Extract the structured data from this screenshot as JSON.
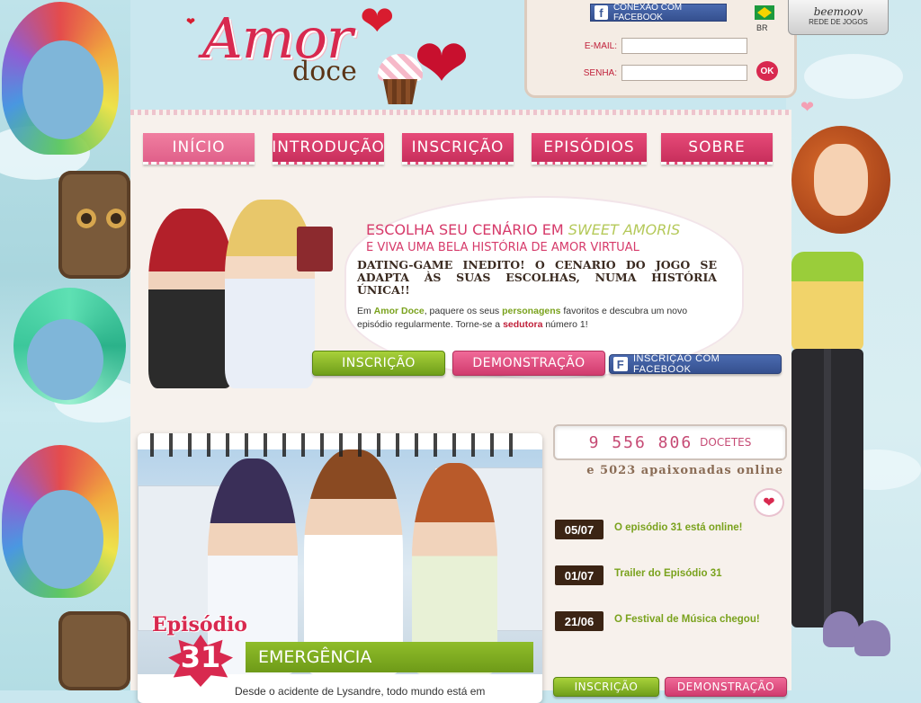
{
  "header": {
    "logo_main": "Amor",
    "logo_sub": "doce",
    "facebook_connect": "CONEXÃO COM FACEBOOK",
    "language": "BR",
    "email_label": "E-MAIL:",
    "password_label": "SENHA:",
    "email_value": "",
    "password_value": "",
    "ok_label": "OK",
    "network_brand": "beemoov",
    "network_sub": "REDE DE JOGOS"
  },
  "nav": {
    "items": [
      {
        "label": "Início"
      },
      {
        "label": "Introdução"
      },
      {
        "label": "Inscrição"
      },
      {
        "label": "Episódios"
      },
      {
        "label": "Sobre"
      }
    ]
  },
  "hero": {
    "title_pre": "ESCOLHA SEU CENÁRIO EM",
    "title_accent": "SWEET AMORIS",
    "subtitle": "E VIVA UMA BELA HISTÓRIA DE AMOR VIRTUAL",
    "tagline": "DATING-GAME INEDITO! O CENARIO DO JOGO SE ADAPTA ÀS SUAS ESCOLHAS, NUMA HISTÓRIA ÚNICA!!",
    "desc_1": "Em",
    "desc_brand": "Amor Doce",
    "desc_2": ", paquere os seus",
    "desc_chars": "personagens",
    "desc_3": "favoritos e descubra um novo episódio regularmente. Torne-se a",
    "desc_seductress": "sedutora",
    "desc_4": "número 1!",
    "btn_signup": "Inscrição",
    "btn_demo": "Demonstração",
    "btn_fb_signup": "INSCRIÇÃO COM FACEBOOK"
  },
  "episode": {
    "label": "Episódio",
    "number": "31",
    "title": "Emergência",
    "snippet": "Desde o acidente de Lysandre, todo mundo está em"
  },
  "stats": {
    "count": "9 556 806",
    "count_unit": "DOCETES",
    "online": "e 5023 apaixonadas online"
  },
  "news": [
    {
      "date": "05/07",
      "title": "O episódio 31 está online!"
    },
    {
      "date": "01/07",
      "title": "Trailer do Episódio 31"
    },
    {
      "date": "21/06",
      "title": "O Festival de Música chegou!"
    }
  ],
  "bottom_buttons": {
    "signup": "Inscrição",
    "demo": "Demonstração"
  },
  "colors": {
    "brand_pink": "#d8294f",
    "nav_pink": "#e64a78",
    "green": "#7aa21d",
    "facebook_blue": "#3b5998"
  }
}
